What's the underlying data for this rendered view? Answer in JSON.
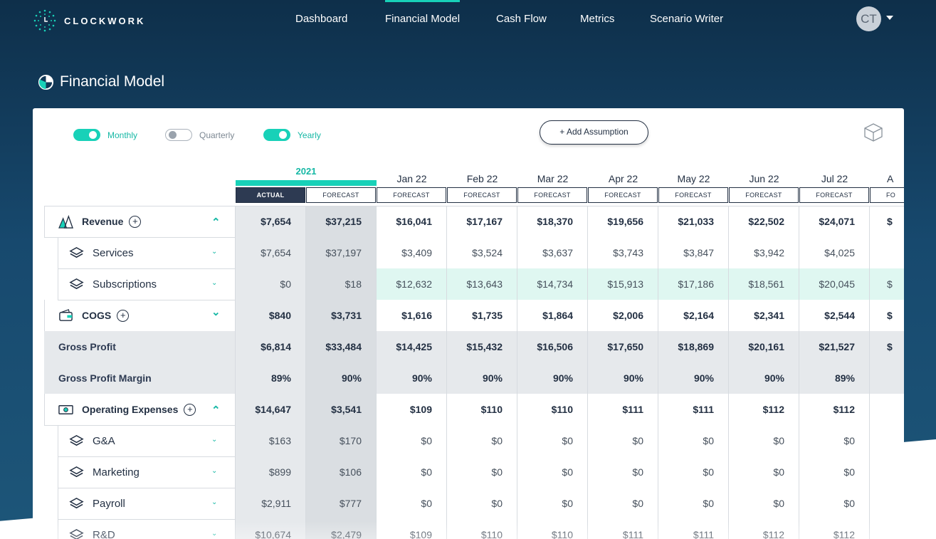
{
  "brand": {
    "name": "CLOCKWORK"
  },
  "nav": {
    "items": [
      {
        "label": "Dashboard"
      },
      {
        "label": "Financial Model"
      },
      {
        "label": "Cash Flow"
      },
      {
        "label": "Metrics"
      },
      {
        "label": "Scenario Writer"
      }
    ],
    "active": "Financial Model"
  },
  "user": {
    "initials": "CT"
  },
  "page": {
    "title": "Financial Model"
  },
  "toggles": [
    {
      "label": "Monthly",
      "on": true
    },
    {
      "label": "Quarterly",
      "on": false
    },
    {
      "label": "Yearly",
      "on": true
    }
  ],
  "add_assumption_label": "+ Add Assumption",
  "colors": {
    "accent": "#18d1b8",
    "navy": "#2d3a52",
    "highlight": "#dff7f1",
    "shaded": "#e6e9ec",
    "shaded_dark": "#dadee2"
  },
  "columns": {
    "year_label": "2021",
    "year_tags": [
      "ACTUAL",
      "FORECAST"
    ],
    "months": [
      "Jan 22",
      "Feb 22",
      "Mar 22",
      "Apr 22",
      "May 22",
      "Jun 22",
      "Jul 22",
      "A"
    ],
    "month_tag": "FORECAST",
    "partial_tag": "FO"
  },
  "rows": [
    {
      "label": "Revenue",
      "type": "group",
      "icon": "revenue-icon",
      "plus": true,
      "chevron": "up",
      "values": [
        "$7,654",
        "$37,215",
        "$16,041",
        "$17,167",
        "$18,370",
        "$19,656",
        "$21,033",
        "$22,502",
        "$24,071",
        "$"
      ]
    },
    {
      "label": "Services",
      "type": "child",
      "icon": "layers-icon",
      "chevron": "down",
      "values": [
        "$7,654",
        "$37,197",
        "$3,409",
        "$3,524",
        "$3,637",
        "$3,743",
        "$3,847",
        "$3,942",
        "$4,025",
        ""
      ]
    },
    {
      "label": "Subscriptions",
      "type": "child-highlight",
      "icon": "layers-icon",
      "chevron": "down",
      "values": [
        "$0",
        "$18",
        "$12,632",
        "$13,643",
        "$14,734",
        "$15,913",
        "$17,186",
        "$18,561",
        "$20,045",
        "$"
      ]
    },
    {
      "label": "COGS",
      "type": "group",
      "icon": "cogs-icon",
      "plus": true,
      "chevron": "down-bold",
      "values": [
        "$840",
        "$3,731",
        "$1,616",
        "$1,735",
        "$1,864",
        "$2,006",
        "$2,164",
        "$2,341",
        "$2,544",
        "$"
      ]
    },
    {
      "label": "Gross Profit",
      "type": "summary",
      "values": [
        "$6,814",
        "$33,484",
        "$14,425",
        "$15,432",
        "$16,506",
        "$17,650",
        "$18,869",
        "$20,161",
        "$21,527",
        "$"
      ]
    },
    {
      "label": "Gross Profit Margin",
      "type": "summary",
      "values": [
        "89%",
        "90%",
        "90%",
        "90%",
        "90%",
        "90%",
        "90%",
        "90%",
        "89%",
        ""
      ]
    },
    {
      "label": "Operating Expenses",
      "type": "group",
      "icon": "opex-icon",
      "plus": true,
      "chevron": "up",
      "values": [
        "$14,647",
        "$3,541",
        "$109",
        "$110",
        "$110",
        "$111",
        "$111",
        "$112",
        "$112",
        ""
      ]
    },
    {
      "label": "G&A",
      "type": "child",
      "icon": "layers-icon",
      "chevron": "down",
      "values": [
        "$163",
        "$170",
        "$0",
        "$0",
        "$0",
        "$0",
        "$0",
        "$0",
        "$0",
        ""
      ]
    },
    {
      "label": "Marketing",
      "type": "child",
      "icon": "layers-icon",
      "chevron": "down",
      "values": [
        "$899",
        "$106",
        "$0",
        "$0",
        "$0",
        "$0",
        "$0",
        "$0",
        "$0",
        ""
      ]
    },
    {
      "label": "Payroll",
      "type": "child",
      "icon": "layers-icon",
      "chevron": "down",
      "values": [
        "$2,911",
        "$777",
        "$0",
        "$0",
        "$0",
        "$0",
        "$0",
        "$0",
        "$0",
        ""
      ]
    },
    {
      "label": "R&D",
      "type": "child",
      "icon": "layers-icon",
      "chevron": "down",
      "values": [
        "$10,674",
        "$2,479",
        "$109",
        "$110",
        "$110",
        "$111",
        "$111",
        "$112",
        "$112",
        ""
      ]
    }
  ]
}
